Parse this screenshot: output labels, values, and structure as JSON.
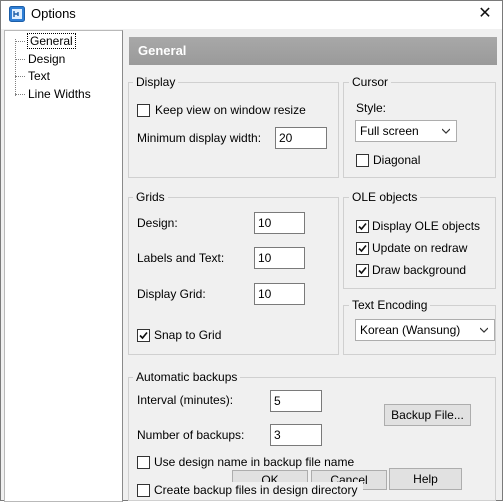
{
  "window": {
    "title": "Options",
    "close_glyph": "✕"
  },
  "tree": {
    "items": [
      {
        "label": "General",
        "selected": true
      },
      {
        "label": "Design"
      },
      {
        "label": "Text"
      },
      {
        "label": "Line Widths"
      }
    ]
  },
  "header": {
    "title": "General"
  },
  "display": {
    "group_title": "Display",
    "keep_view_label": "Keep view on window resize",
    "keep_view_checked": false,
    "min_width_label": "Minimum display width:",
    "min_width_value": "20"
  },
  "cursor": {
    "group_title": "Cursor",
    "style_label": "Style:",
    "style_value": "Full screen",
    "diagonal_label": "Diagonal",
    "diagonal_checked": false
  },
  "grids": {
    "group_title": "Grids",
    "design_label": "Design:",
    "design_value": "10",
    "labels_text_label": "Labels and Text:",
    "labels_text_value": "10",
    "display_grid_label": "Display Grid:",
    "display_grid_value": "10",
    "snap_label": "Snap to Grid",
    "snap_checked": true
  },
  "ole": {
    "group_title": "OLE objects",
    "display_ole_label": "Display OLE objects",
    "display_ole_checked": true,
    "update_redraw_label": "Update on redraw",
    "update_redraw_checked": true,
    "draw_bg_label": "Draw background",
    "draw_bg_checked": true
  },
  "encoding": {
    "group_title": "Text Encoding",
    "value": "Korean (Wansung)"
  },
  "backups": {
    "group_title": "Automatic backups",
    "interval_label": "Interval (minutes):",
    "interval_value": "5",
    "count_label": "Number of backups:",
    "count_value": "3",
    "backup_file_button": "Backup File...",
    "use_name_label": "Use design name in backup file name",
    "use_name_checked": false,
    "create_in_dir_label": "Create backup files in design directory",
    "create_in_dir_checked": false
  },
  "buttons": {
    "ok": "OK",
    "cancel": "Cancel",
    "help": "Help"
  }
}
